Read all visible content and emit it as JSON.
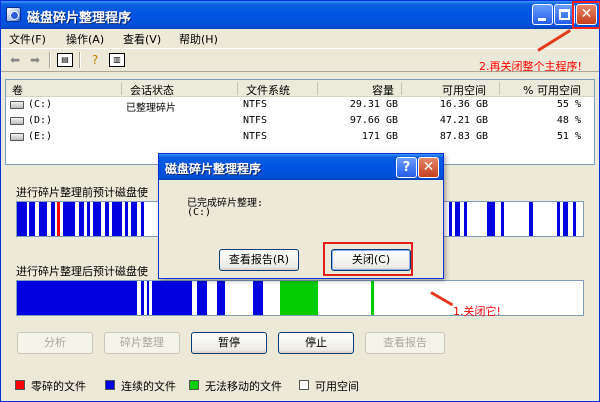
{
  "window": {
    "title": "磁盘碎片整理程序",
    "controls": {
      "minimize": "_",
      "maximize": "□",
      "close": "✕"
    }
  },
  "menu": [
    "文件(F)",
    "操作(A)",
    "查看(V)",
    "帮助(H)"
  ],
  "toolbar_icons": [
    "back-arrow-icon",
    "forward-arrow-icon",
    "properties-icon",
    "help-icon",
    "console-tree-icon"
  ],
  "annotations": {
    "step2": "2.再关闭整个主程序!",
    "step1": "1.关闭它!"
  },
  "volumes": {
    "columns": [
      "卷",
      "会话状态",
      "文件系统",
      "容量",
      "可用空间",
      "% 可用空间"
    ],
    "rows": [
      {
        "volume": "(C:)",
        "status": "已整理碎片",
        "fs": "NTFS",
        "capacity": "29.31 GB",
        "free": "16.36 GB",
        "pct": "55 %"
      },
      {
        "volume": "(D:)",
        "status": "",
        "fs": "NTFS",
        "capacity": "97.66 GB",
        "free": "47.21 GB",
        "pct": "48 %"
      },
      {
        "volume": "(E:)",
        "status": "",
        "fs": "NTFS",
        "capacity": "171 GB",
        "free": "87.83 GB",
        "pct": "51 %"
      }
    ]
  },
  "analysis": {
    "before_label": "进行碎片整理前预计磁盘使",
    "after_label": "进行碎片整理后预计磁盘使"
  },
  "buttons": {
    "analyze": "分析",
    "defragment": "碎片整理",
    "pause": "暂停",
    "stop": "停止",
    "view_report": "查看报告"
  },
  "legend": [
    {
      "label": "零碎的文件",
      "color": "#ff0000"
    },
    {
      "label": "连续的文件",
      "color": "#0000e0"
    },
    {
      "label": "无法移动的文件",
      "color": "#00cc00"
    },
    {
      "label": "可用空间",
      "color": "#ffffff"
    }
  ],
  "dialog": {
    "title": "磁盘碎片整理程序",
    "message": "已完成碎片整理:",
    "volume": "(C:)",
    "view_report": "查看报告(R)",
    "close": "关闭(C)",
    "help": "?",
    "x": "✕"
  },
  "colors": {
    "title_blue": "#0054e3",
    "annotation_red": "#ff0000",
    "contiguous_blue": "#0000e0",
    "unmovable_green": "#00cc00"
  }
}
